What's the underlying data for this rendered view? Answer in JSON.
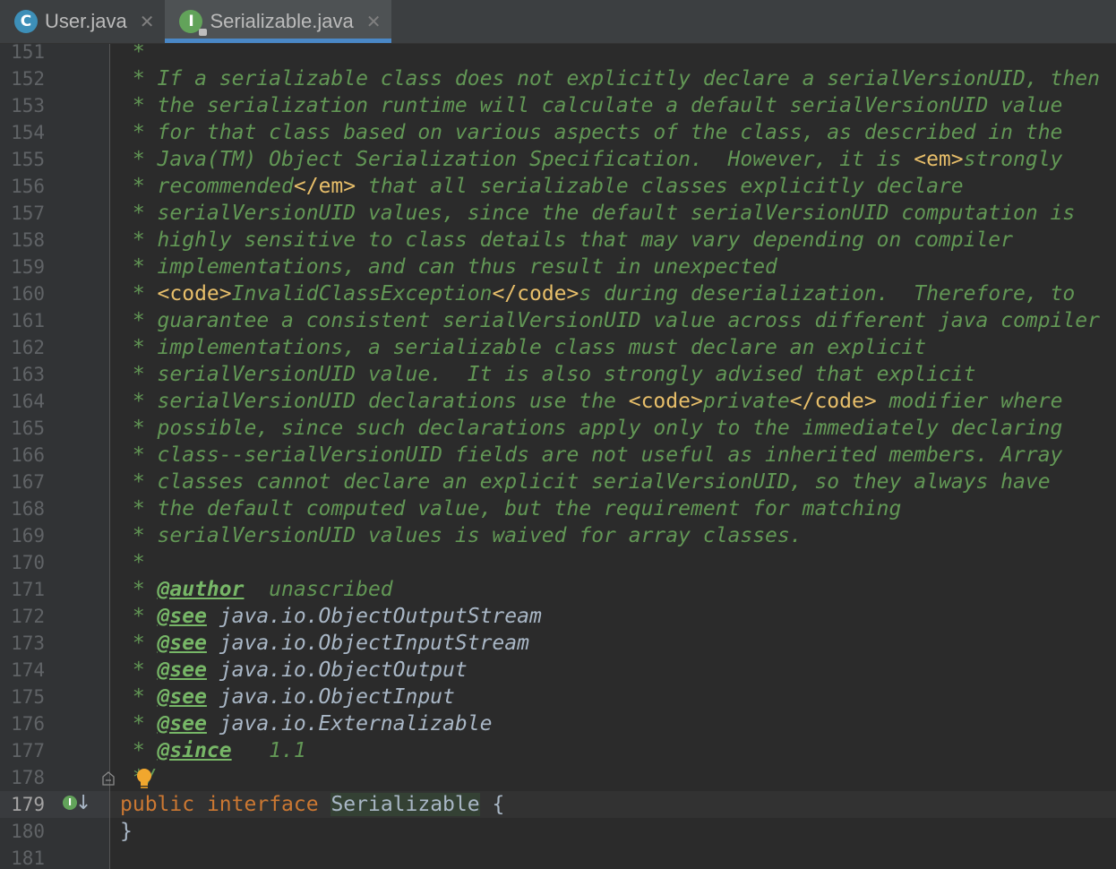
{
  "tabs": [
    {
      "label": "User.java",
      "icon": "class-icon",
      "letter": "C",
      "active": false
    },
    {
      "label": "Serializable.java",
      "icon": "interface-icon",
      "letter": "I",
      "active": true
    }
  ],
  "lines": [
    {
      "num": "151",
      "segs": [
        {
          "t": " *",
          "c": "doc"
        }
      ]
    },
    {
      "num": "152",
      "segs": [
        {
          "t": " * If a serializable class does not explicitly declare a serialVersionUID, then",
          "c": "doc"
        }
      ]
    },
    {
      "num": "153",
      "segs": [
        {
          "t": " * the serialization runtime will calculate a default serialVersionUID value",
          "c": "doc"
        }
      ]
    },
    {
      "num": "154",
      "segs": [
        {
          "t": " * for that class based on various aspects of the class, as described in the",
          "c": "doc"
        }
      ]
    },
    {
      "num": "155",
      "segs": [
        {
          "t": " * Java(TM) Object Serialization Specification.  However, it is ",
          "c": "doc"
        },
        {
          "t": "<em>",
          "c": "html"
        },
        {
          "t": "strongly",
          "c": "doc"
        }
      ]
    },
    {
      "num": "156",
      "segs": [
        {
          "t": " * recommended",
          "c": "doc"
        },
        {
          "t": "</em>",
          "c": "html"
        },
        {
          "t": " that all serializable classes explicitly declare",
          "c": "doc"
        }
      ]
    },
    {
      "num": "157",
      "segs": [
        {
          "t": " * serialVersionUID values, since the default serialVersionUID computation is",
          "c": "doc"
        }
      ]
    },
    {
      "num": "158",
      "segs": [
        {
          "t": " * highly sensitive to class details that may vary depending on compiler",
          "c": "doc"
        }
      ]
    },
    {
      "num": "159",
      "segs": [
        {
          "t": " * implementations, and can thus result in unexpected",
          "c": "doc"
        }
      ]
    },
    {
      "num": "160",
      "segs": [
        {
          "t": " * ",
          "c": "doc"
        },
        {
          "t": "<code>",
          "c": "html"
        },
        {
          "t": "InvalidClassException",
          "c": "doc"
        },
        {
          "t": "</code>",
          "c": "html"
        },
        {
          "t": "s during deserialization.  Therefore, to",
          "c": "doc"
        }
      ]
    },
    {
      "num": "161",
      "segs": [
        {
          "t": " * guarantee a consistent serialVersionUID value across different java compiler",
          "c": "doc"
        }
      ]
    },
    {
      "num": "162",
      "segs": [
        {
          "t": " * implementations, a serializable class must declare an explicit",
          "c": "doc"
        }
      ]
    },
    {
      "num": "163",
      "segs": [
        {
          "t": " * serialVersionUID value.  It is also strongly advised that explicit",
          "c": "doc"
        }
      ]
    },
    {
      "num": "164",
      "segs": [
        {
          "t": " * serialVersionUID declarations use the ",
          "c": "doc"
        },
        {
          "t": "<code>",
          "c": "html"
        },
        {
          "t": "private",
          "c": "doc"
        },
        {
          "t": "</code>",
          "c": "html"
        },
        {
          "t": " modifier where",
          "c": "doc"
        }
      ]
    },
    {
      "num": "165",
      "segs": [
        {
          "t": " * possible, since such declarations apply only to the immediately declaring",
          "c": "doc"
        }
      ]
    },
    {
      "num": "166",
      "segs": [
        {
          "t": " * class--serialVersionUID fields are not useful as inherited members. Array",
          "c": "doc"
        }
      ]
    },
    {
      "num": "167",
      "segs": [
        {
          "t": " * classes cannot declare an explicit serialVersionUID, so they always have",
          "c": "doc"
        }
      ]
    },
    {
      "num": "168",
      "segs": [
        {
          "t": " * the default computed value, but the requirement for matching",
          "c": "doc"
        }
      ]
    },
    {
      "num": "169",
      "segs": [
        {
          "t": " * serialVersionUID values is waived for array classes.",
          "c": "doc"
        }
      ]
    },
    {
      "num": "170",
      "segs": [
        {
          "t": " *",
          "c": "doc"
        }
      ]
    },
    {
      "num": "171",
      "segs": [
        {
          "t": " * ",
          "c": "doc"
        },
        {
          "t": "@author",
          "c": "tag"
        },
        {
          "t": "  unascribed",
          "c": "doc"
        }
      ]
    },
    {
      "num": "172",
      "segs": [
        {
          "t": " * ",
          "c": "doc"
        },
        {
          "t": "@see",
          "c": "tag"
        },
        {
          "t": " java.io.ObjectOutputStream",
          "c": "ref"
        }
      ]
    },
    {
      "num": "173",
      "segs": [
        {
          "t": " * ",
          "c": "doc"
        },
        {
          "t": "@see",
          "c": "tag"
        },
        {
          "t": " java.io.ObjectInputStream",
          "c": "ref"
        }
      ]
    },
    {
      "num": "174",
      "segs": [
        {
          "t": " * ",
          "c": "doc"
        },
        {
          "t": "@see",
          "c": "tag"
        },
        {
          "t": " java.io.ObjectOutput",
          "c": "ref"
        }
      ]
    },
    {
      "num": "175",
      "segs": [
        {
          "t": " * ",
          "c": "doc"
        },
        {
          "t": "@see",
          "c": "tag"
        },
        {
          "t": " java.io.ObjectInput",
          "c": "ref"
        }
      ]
    },
    {
      "num": "176",
      "segs": [
        {
          "t": " * ",
          "c": "doc"
        },
        {
          "t": "@see",
          "c": "tag"
        },
        {
          "t": " java.io.Externalizable",
          "c": "ref"
        }
      ]
    },
    {
      "num": "177",
      "segs": [
        {
          "t": " * ",
          "c": "doc"
        },
        {
          "t": "@since",
          "c": "tag"
        },
        {
          "t": "   1.1",
          "c": "doc"
        }
      ]
    },
    {
      "num": "178",
      "segs": [
        {
          "t": " */",
          "c": "doc"
        }
      ]
    },
    {
      "num": "179",
      "segs": [
        {
          "t": "public",
          "c": "kw"
        },
        {
          "t": " ",
          "c": "plain"
        },
        {
          "t": "interface",
          "c": "kw"
        },
        {
          "t": " ",
          "c": "plain"
        },
        {
          "t": "Serializable",
          "c": "cls"
        },
        {
          "t": " {",
          "c": "plain"
        }
      ],
      "current": true
    },
    {
      "num": "180",
      "segs": [
        {
          "t": "}",
          "c": "plain"
        }
      ]
    },
    {
      "num": "181",
      "segs": []
    }
  ],
  "colors": {
    "background": "#2b2b2b",
    "doc_comment": "#629755",
    "doc_tag": "#77b767",
    "html_tag": "#e8bf6a",
    "keyword": "#cc7832",
    "identifier": "#a9b7c6",
    "tab_underline": "#4a88c7"
  }
}
